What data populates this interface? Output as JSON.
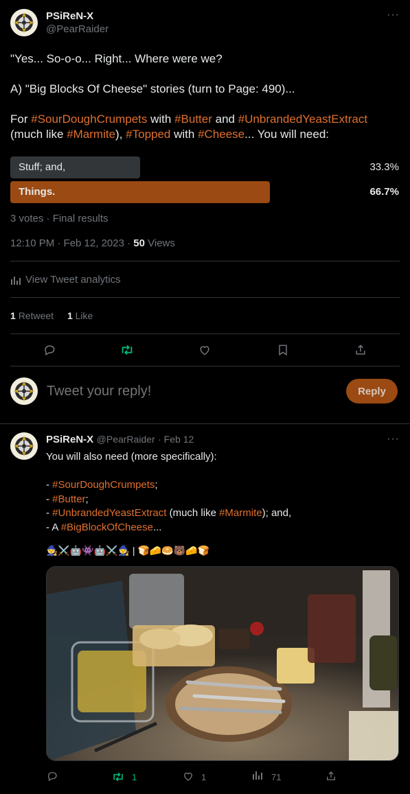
{
  "colors": {
    "accent": "#e0702e",
    "poll_win": "#9a4a12",
    "poll_lose": "#333639",
    "retweet_green": "#00ba7c"
  },
  "tweet": {
    "author_name": "PSiReN-X",
    "author_handle": "@PearRaider",
    "lines": [
      [
        {
          "t": "\"Yes... So-o-o... Right... Where were we?"
        }
      ],
      [],
      [
        {
          "t": "A) \"Big Blocks Of Cheese\" stories (turn to Page: 490)..."
        }
      ],
      [],
      [
        {
          "t": "For "
        },
        {
          "t": "#SourDoughCrumpets",
          "tag": true
        },
        {
          "t": " with "
        },
        {
          "t": "#Butter",
          "tag": true
        },
        {
          "t": " and "
        },
        {
          "t": "#UnbrandedYeastExtract",
          "tag": true
        }
      ],
      [
        {
          "t": "(much like "
        },
        {
          "t": "#Marmite",
          "tag": true
        },
        {
          "t": "), "
        },
        {
          "t": "#Topped",
          "tag": true
        },
        {
          "t": " with "
        },
        {
          "t": "#Cheese",
          "tag": true
        },
        {
          "t": "...  You will need:"
        }
      ]
    ],
    "poll": {
      "options": [
        {
          "label": "Stuff; and,",
          "percent": "33.3%",
          "share": 0.333,
          "winner": false
        },
        {
          "label": "Things.",
          "percent": "66.7%",
          "share": 0.667,
          "winner": true
        }
      ],
      "summary": "3 votes · Final results"
    },
    "timestamp": "12:10 PM · Feb 12, 2023 · ",
    "views_count": "50",
    "views_label": " Views",
    "analytics_label": "View Tweet analytics",
    "retweets_count": "1",
    "retweets_label": "Retweet",
    "likes_count": "1",
    "likes_label": "Like",
    "icons": [
      "reply-icon",
      "retweet-icon",
      "like-icon",
      "bookmark-icon",
      "share-icon"
    ]
  },
  "composer": {
    "placeholder": "Tweet your reply!",
    "button_label": "Reply"
  },
  "reply": {
    "author_name": "PSiReN-X",
    "author_handle": "@PearRaider",
    "date": "· Feb 12",
    "lines": [
      [
        {
          "t": "You will also need (more specifically):"
        }
      ],
      [],
      [
        {
          "t": "- "
        },
        {
          "t": "#SourDoughCrumpets",
          "tag": true
        },
        {
          "t": ";"
        }
      ],
      [
        {
          "t": "- "
        },
        {
          "t": "#Butter",
          "tag": true
        },
        {
          "t": ";"
        }
      ],
      [
        {
          "t": "- "
        },
        {
          "t": "#UnbrandedYeastExtract",
          "tag": true
        },
        {
          "t": " (much like "
        },
        {
          "t": "#Marmite",
          "tag": true
        },
        {
          "t": "); and,"
        }
      ],
      [
        {
          "t": "- A "
        },
        {
          "t": "#BigBlockOfCheese",
          "tag": true
        },
        {
          "t": "..."
        }
      ]
    ],
    "emoji_line": "🧙⚔️🤖👾🤖⚔️🧙 | 🍞🧀🥯🐻🧀🍞",
    "actions": {
      "retweets": "1",
      "likes": "1",
      "views": "71"
    }
  }
}
